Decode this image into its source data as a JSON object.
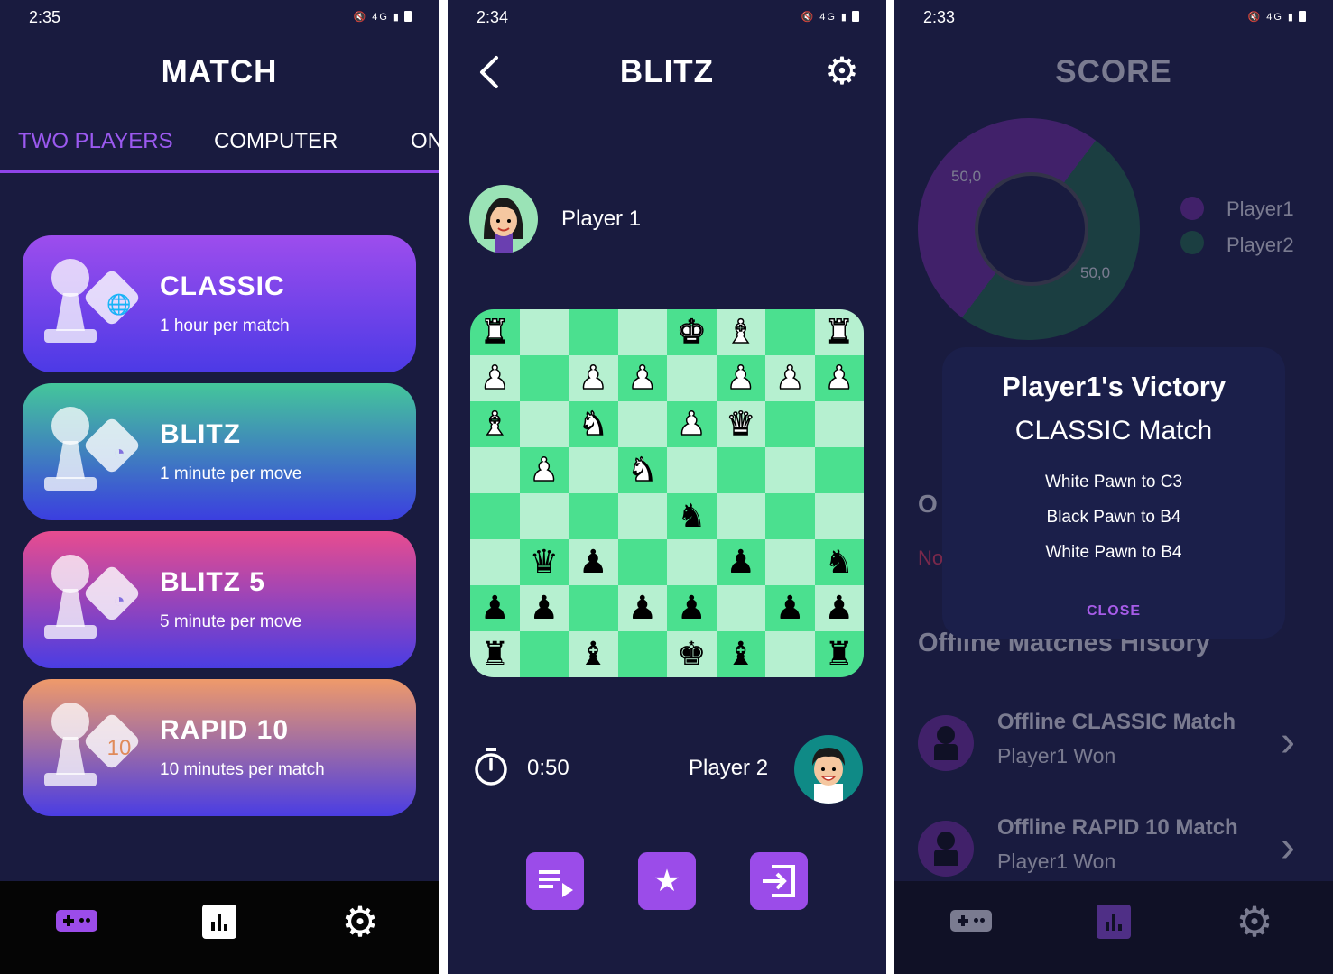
{
  "screens": {
    "match": {
      "status_time": "2:35",
      "title": "MATCH",
      "tabs": [
        "TWO PLAYERS",
        "COMPUTER",
        "ON"
      ],
      "modes": [
        {
          "name": "CLASSIC",
          "desc": "1 hour per match",
          "badge": "globe-icon"
        },
        {
          "name": "BLITZ",
          "desc": "1 minute per move",
          "badge": "clock-icon"
        },
        {
          "name": "BLITZ 5",
          "desc": "5 minute per move",
          "badge": "clock-icon"
        },
        {
          "name": "RAPID 10",
          "desc": "10 minutes per match",
          "badge_text": "10"
        }
      ],
      "nav_accent": "#9b4ce9"
    },
    "game": {
      "status_time": "2:34",
      "title": "BLITZ",
      "player1": "Player 1",
      "player2": "Player 2",
      "timer": "0:50",
      "board_rows": [
        [
          "wR",
          "",
          "",
          "",
          "wK",
          "wB",
          "",
          "wR"
        ],
        [
          "wP",
          "",
          "wP",
          "wP",
          "",
          "wP",
          "wP",
          "wP"
        ],
        [
          "wB",
          "",
          "wN",
          "",
          "wP",
          "wQ",
          "",
          ""
        ],
        [
          "",
          "wP",
          "",
          "wN",
          "",
          "",
          "",
          ""
        ],
        [
          "",
          "",
          "",
          "",
          "bN",
          "",
          "",
          ""
        ],
        [
          "",
          "bQ",
          "bP",
          "",
          "",
          "bP",
          "",
          "bN"
        ],
        [
          "bP",
          "bP",
          "",
          "bP",
          "bP",
          "",
          "bP",
          "bP"
        ],
        [
          "bR",
          "",
          "bB",
          "",
          "bK",
          "bB",
          "",
          "bR"
        ]
      ],
      "board_colors": {
        "dark": "#4be08f",
        "light": "#b6f0d0"
      }
    },
    "score": {
      "status_time": "2:33",
      "title": "SCORE",
      "chart_data": {
        "type": "pie",
        "categories": [
          "Player1",
          "Player2"
        ],
        "values": [
          50.0,
          50.0
        ],
        "data_labels": [
          "50,0",
          "50,0"
        ],
        "colors": [
          "#7a2ba6",
          "#1f6e44"
        ],
        "legend": "right"
      },
      "hidden_fragments": {
        "section_letter": "O",
        "subtext": "No"
      },
      "history_title": "Offline Matches History",
      "history": [
        {
          "name": "Offline CLASSIC Match",
          "status": "Player1 Won"
        },
        {
          "name": "Offline RAPID 10 Match",
          "status": "Player1 Won"
        }
      ],
      "modal": {
        "title": "Player1's Victory",
        "subtitle": "CLASSIC Match",
        "moves": [
          "White Pawn to C3",
          "Black Pawn to B4",
          "White Pawn to B4"
        ],
        "close": "CLOSE"
      }
    }
  }
}
